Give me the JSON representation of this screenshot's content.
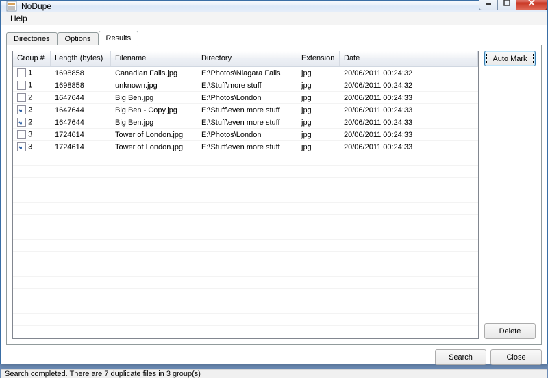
{
  "window": {
    "title": "NoDupe"
  },
  "menu": {
    "help": "Help"
  },
  "tabs": {
    "directories": "Directories",
    "options": "Options",
    "results": "Results",
    "active": "results"
  },
  "columns": {
    "group": "Group #",
    "length": "Length (bytes)",
    "filename": "Filename",
    "directory": "Directory",
    "extension": "Extension",
    "date": "Date"
  },
  "rows": [
    {
      "checked": false,
      "group": "1",
      "length": "1698858",
      "filename": "Canadian Falls.jpg",
      "directory": "E:\\Photos\\Niagara Falls",
      "ext": "jpg",
      "date": "20/06/2011 00:24:32"
    },
    {
      "checked": false,
      "group": "1",
      "length": "1698858",
      "filename": "unknown.jpg",
      "directory": "E:\\Stuff\\more stuff",
      "ext": "jpg",
      "date": "20/06/2011 00:24:32"
    },
    {
      "checked": false,
      "group": "2",
      "length": "1647644",
      "filename": "Big Ben.jpg",
      "directory": "E:\\Photos\\London",
      "ext": "jpg",
      "date": "20/06/2011 00:24:33"
    },
    {
      "checked": true,
      "group": "2",
      "length": "1647644",
      "filename": "Big Ben - Copy.jpg",
      "directory": "E:\\Stuff\\even more stuff",
      "ext": "jpg",
      "date": "20/06/2011 00:24:33"
    },
    {
      "checked": true,
      "group": "2",
      "length": "1647644",
      "filename": "Big Ben.jpg",
      "directory": "E:\\Stuff\\even more stuff",
      "ext": "jpg",
      "date": "20/06/2011 00:24:33"
    },
    {
      "checked": false,
      "group": "3",
      "length": "1724614",
      "filename": "Tower of London.jpg",
      "directory": "E:\\Photos\\London",
      "ext": "jpg",
      "date": "20/06/2011 00:24:33"
    },
    {
      "checked": true,
      "group": "3",
      "length": "1724614",
      "filename": "Tower of London.jpg",
      "directory": "E:\\Stuff\\even more stuff",
      "ext": "jpg",
      "date": "20/06/2011 00:24:33"
    }
  ],
  "buttons": {
    "automark": "Auto Mark",
    "delete": "Delete",
    "search": "Search",
    "close": "Close"
  },
  "status": "Search completed. There are 7 duplicate files in 3 group(s)"
}
